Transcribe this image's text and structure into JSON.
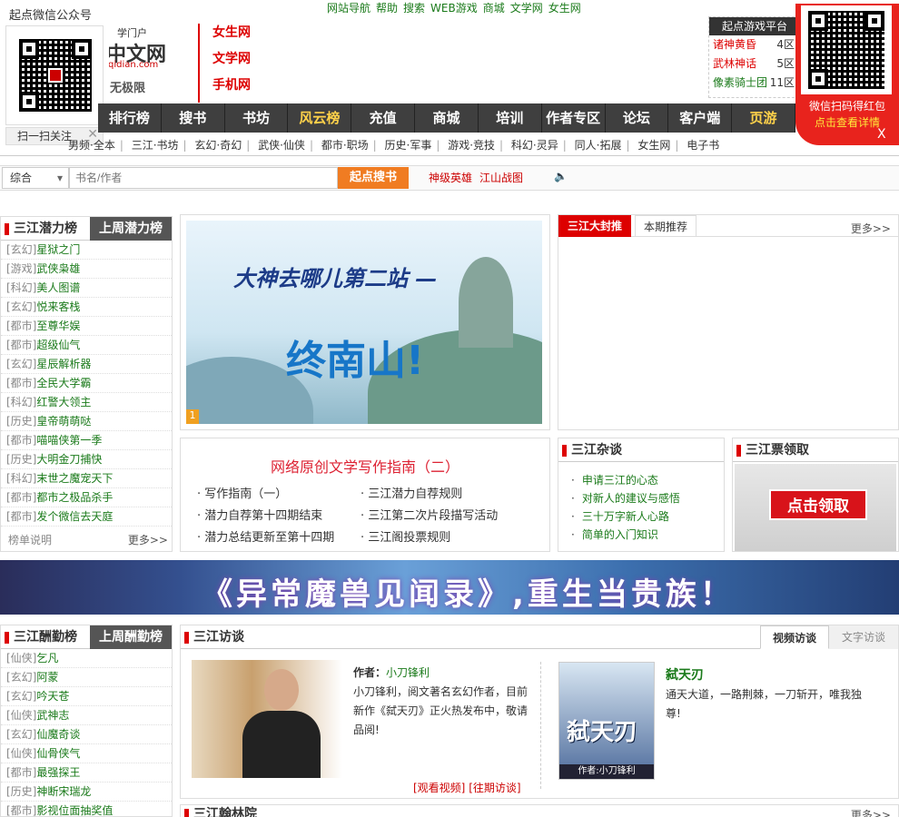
{
  "top_links": [
    "网站导航",
    "帮助",
    "搜索",
    "WEB游戏",
    "商城",
    "文学网",
    "女生网"
  ],
  "qr_left": {
    "title": "起点微信公众号",
    "follow": "扫一扫关注",
    "close": "✕"
  },
  "logo": {
    "l1": "学门户",
    "l2": "中文网",
    "l3": "qidian.com",
    "l4": "无极限"
  },
  "channels": [
    "女生网",
    "文学网",
    "手机网"
  ],
  "rank_box": {
    "header": "起点游戏平台",
    "rows": [
      {
        "name": "诸神黄昏",
        "server": "4区"
      },
      {
        "name": "武林神话",
        "server": "5区"
      },
      {
        "name": "像素骑士团",
        "server": "11区"
      }
    ]
  },
  "redpack": {
    "line1": "微信扫码得红包",
    "line2": "点击查看详情",
    "close": "X"
  },
  "nav": [
    "排行榜",
    "搜书",
    "书坊",
    "风云榜",
    "充值",
    "商城",
    "培训",
    "作者专区",
    "论坛",
    "客户端",
    "页游"
  ],
  "nav_highlight": [
    "风云榜",
    "页游"
  ],
  "subnav": [
    "男频·全本",
    "三江·书坊",
    "玄幻·奇幻",
    "武侠·仙侠",
    "都市·职场",
    "历史·军事",
    "游戏·竞技",
    "科幻·灵异",
    "同人·拓展",
    "女生网",
    "电子书"
  ],
  "search": {
    "select": "综合",
    "placeholder": "书名/作者",
    "button": "起点搜书",
    "hot": [
      "神级英雄",
      "江山战图"
    ],
    "speaker": "🔈"
  },
  "potential": {
    "title": "三江潜力榜",
    "alt": "上周潜力榜",
    "items": [
      {
        "cat": "[玄幻]",
        "name": "星狱之门"
      },
      {
        "cat": "[游戏]",
        "name": "武侠枭雄"
      },
      {
        "cat": "[科幻]",
        "name": "美人图谱"
      },
      {
        "cat": "[玄幻]",
        "name": "悦来客栈"
      },
      {
        "cat": "[都市]",
        "name": "至尊华娱"
      },
      {
        "cat": "[都市]",
        "name": "超级仙气"
      },
      {
        "cat": "[玄幻]",
        "name": "星辰解析器"
      },
      {
        "cat": "[都市]",
        "name": "全民大学霸"
      },
      {
        "cat": "[科幻]",
        "name": "红警大领主"
      },
      {
        "cat": "[历史]",
        "name": "皇帝萌萌哒"
      },
      {
        "cat": "[都市]",
        "name": "喵喵侠第一季"
      },
      {
        "cat": "[历史]",
        "name": "大明金刀捕快"
      },
      {
        "cat": "[科幻]",
        "name": "末世之魔宠天下"
      },
      {
        "cat": "[都市]",
        "name": "都市之极品杀手"
      },
      {
        "cat": "[都市]",
        "name": "发个微信去天庭"
      }
    ],
    "foot": "榜单说明",
    "more": "更多>>"
  },
  "banner": {
    "line1": "大神去哪儿第二站 —",
    "line2": "终南山!",
    "index": "1"
  },
  "guide": {
    "title": "网络原创文学写作指南（二）",
    "col1": [
      "写作指南（一）",
      "潜力自荐第十四期结束",
      "潜力总结更新至第十四期"
    ],
    "col2": [
      "三江潜力自荐规则",
      "三江第二次片段描写活动",
      "三江阁投票规则"
    ]
  },
  "cover": {
    "tab1": "三江大封推",
    "tab2": "本期推荐",
    "more": "更多>>"
  },
  "zatan": {
    "title": "三江杂谈",
    "items": [
      "申请三江的心态",
      "对新人的建议与感悟",
      "三十万字新人心路",
      "简单的入门知识"
    ]
  },
  "ticket": {
    "title": "三江票领取",
    "button": "点击领取"
  },
  "ad": {
    "text": "《异常魔兽见闻录》,重生当贵族！"
  },
  "diligence": {
    "title": "三江酬勤榜",
    "alt": "上周酬勤榜",
    "items": [
      {
        "cat": "[仙侠]",
        "name": "乞凡"
      },
      {
        "cat": "[玄幻]",
        "name": "阿蒙"
      },
      {
        "cat": "[玄幻]",
        "name": "吟天苍"
      },
      {
        "cat": "[仙侠]",
        "name": "武神志"
      },
      {
        "cat": "[玄幻]",
        "name": "仙魔奇谈"
      },
      {
        "cat": "[仙侠]",
        "name": "仙骨侠气"
      },
      {
        "cat": "[都市]",
        "name": "最强探王"
      },
      {
        "cat": "[历史]",
        "name": "神断宋瑞龙"
      },
      {
        "cat": "[都市]",
        "name": "影视位面抽奖值"
      }
    ]
  },
  "interview": {
    "title": "三江访谈",
    "tab_video": "视频访谈",
    "tab_text": "文字访谈",
    "author_label": "作者：",
    "author": "小刀锋利",
    "desc": "小刀锋利，阅文著名玄幻作者，目前新作《弑天刃》正火热发布中，敬请品阅!",
    "link1": "[观看视频]",
    "link2": "[往期访谈]",
    "book_title": "弑天刃",
    "book_cover_title": "弑天刃",
    "book_cover_author": "作者:小刀锋利",
    "book_desc": "通天大道，一路荆棘，一刀斩开，唯我独尊!"
  },
  "bottom": {
    "title": "三江翰林院",
    "more": "更多>>"
  }
}
